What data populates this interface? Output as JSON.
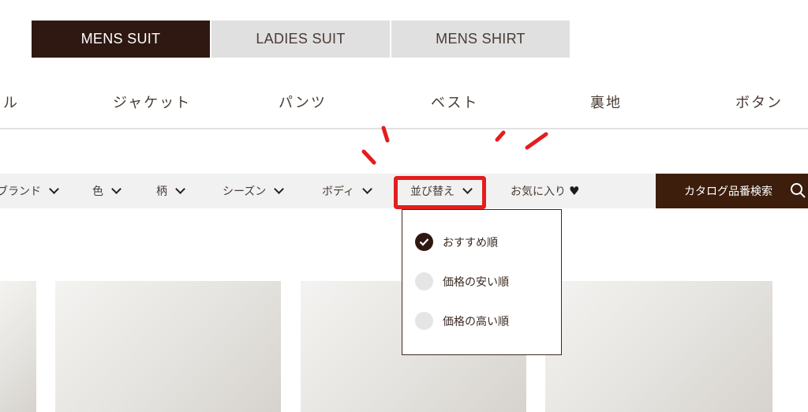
{
  "tabs": [
    {
      "label": "MENS SUIT",
      "active": true
    },
    {
      "label": "LADIES SUIT",
      "active": false
    },
    {
      "label": "MENS SHIRT",
      "active": false
    }
  ],
  "subnav": [
    "ジャケット",
    "パンツ",
    "ベスト",
    "裏地",
    "ボタン"
  ],
  "subnav_partial": "ドル",
  "filters": {
    "brand": "ブランド",
    "color": "色",
    "pattern": "柄",
    "season": "シーズン",
    "body": "ボディ",
    "sort": "並び替え",
    "favorites": "お気に入り",
    "favorites_icon": "heart-icon"
  },
  "catalog_search": {
    "label": "カタログ品番検索",
    "icon": "search-icon"
  },
  "sort_menu": {
    "options": [
      {
        "label": "おすすめ順",
        "selected": true
      },
      {
        "label": "価格の安い順",
        "selected": false
      },
      {
        "label": "価格の高い順",
        "selected": false
      }
    ]
  },
  "colors": {
    "accent_dark": "#2f1812",
    "catalog_bg": "#3d1e0c",
    "highlight_red": "#e41d1d",
    "filter_bg": "#f1f1f1"
  }
}
